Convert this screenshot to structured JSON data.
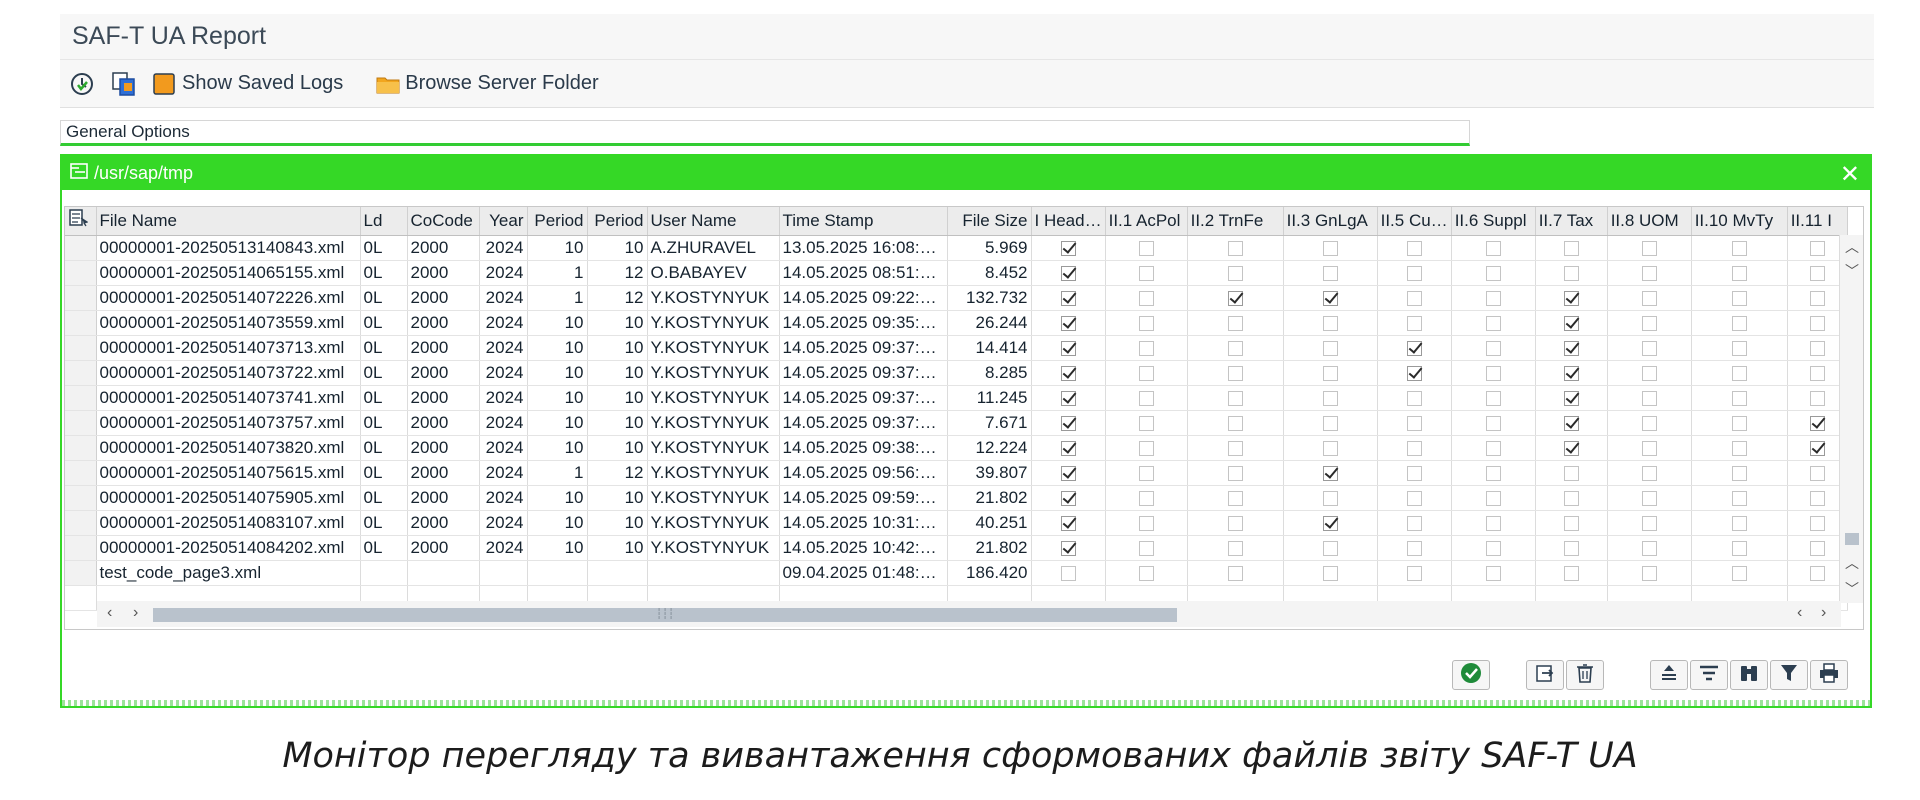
{
  "window": {
    "title": "SAF-T UA Report"
  },
  "toolbar": {
    "show_logs_label": "Show Saved Logs",
    "browse_folder_label": "Browse Server Folder"
  },
  "general_options": {
    "label": "General Options"
  },
  "dialog": {
    "path": "/usr/sap/tmp",
    "close_label": "✕"
  },
  "grid": {
    "columns": [
      "File Name",
      "Ld",
      "CoCode",
      "Year",
      "Period",
      "Period",
      "User Name",
      "Time Stamp",
      "File Size",
      "I Head…",
      "II.1 AcPol",
      "II.2 TrnFe",
      "II.3 GnLgA",
      "II.5 Cu…",
      "II.6 Suppl",
      "II.7 Tax",
      "II.8 UOM",
      "II.10 MvTy",
      "II.11 I"
    ],
    "rows": [
      {
        "file": "00000001-20250513140843.xml",
        "ld": "0L",
        "cocode": "2000",
        "year": "2024",
        "p1": "10",
        "p2": "10",
        "user": "A.ZHURAVEL",
        "ts": "13.05.2025 16:08:…",
        "size": "5.969",
        "flags": [
          1,
          0,
          0,
          0,
          0,
          0,
          0,
          0,
          0,
          0
        ]
      },
      {
        "file": "00000001-20250514065155.xml",
        "ld": "0L",
        "cocode": "2000",
        "year": "2024",
        "p1": "1",
        "p2": "12",
        "user": "O.BABAYEV",
        "ts": "14.05.2025 08:51:…",
        "size": "8.452",
        "flags": [
          1,
          0,
          0,
          0,
          0,
          0,
          0,
          0,
          0,
          0
        ]
      },
      {
        "file": "00000001-20250514072226.xml",
        "ld": "0L",
        "cocode": "2000",
        "year": "2024",
        "p1": "1",
        "p2": "12",
        "user": "Y.KOSTYNYUK",
        "ts": "14.05.2025 09:22:…",
        "size": "132.732",
        "flags": [
          1,
          0,
          1,
          1,
          0,
          0,
          1,
          0,
          0,
          0
        ]
      },
      {
        "file": "00000001-20250514073559.xml",
        "ld": "0L",
        "cocode": "2000",
        "year": "2024",
        "p1": "10",
        "p2": "10",
        "user": "Y.KOSTYNYUK",
        "ts": "14.05.2025 09:35:…",
        "size": "26.244",
        "flags": [
          1,
          0,
          0,
          0,
          0,
          0,
          1,
          0,
          0,
          0
        ]
      },
      {
        "file": "00000001-20250514073713.xml",
        "ld": "0L",
        "cocode": "2000",
        "year": "2024",
        "p1": "10",
        "p2": "10",
        "user": "Y.KOSTYNYUK",
        "ts": "14.05.2025 09:37:…",
        "size": "14.414",
        "flags": [
          1,
          0,
          0,
          0,
          1,
          0,
          1,
          0,
          0,
          0
        ]
      },
      {
        "file": "00000001-20250514073722.xml",
        "ld": "0L",
        "cocode": "2000",
        "year": "2024",
        "p1": "10",
        "p2": "10",
        "user": "Y.KOSTYNYUK",
        "ts": "14.05.2025 09:37:…",
        "size": "8.285",
        "flags": [
          1,
          0,
          0,
          0,
          1,
          0,
          1,
          0,
          0,
          0
        ]
      },
      {
        "file": "00000001-20250514073741.xml",
        "ld": "0L",
        "cocode": "2000",
        "year": "2024",
        "p1": "10",
        "p2": "10",
        "user": "Y.KOSTYNYUK",
        "ts": "14.05.2025 09:37:…",
        "size": "11.245",
        "flags": [
          1,
          0,
          0,
          0,
          0,
          0,
          1,
          0,
          0,
          0
        ]
      },
      {
        "file": "00000001-20250514073757.xml",
        "ld": "0L",
        "cocode": "2000",
        "year": "2024",
        "p1": "10",
        "p2": "10",
        "user": "Y.KOSTYNYUK",
        "ts": "14.05.2025 09:37:…",
        "size": "7.671",
        "flags": [
          1,
          0,
          0,
          0,
          0,
          0,
          1,
          0,
          0,
          1
        ]
      },
      {
        "file": "00000001-20250514073820.xml",
        "ld": "0L",
        "cocode": "2000",
        "year": "2024",
        "p1": "10",
        "p2": "10",
        "user": "Y.KOSTYNYUK",
        "ts": "14.05.2025 09:38:…",
        "size": "12.224",
        "flags": [
          1,
          0,
          0,
          0,
          0,
          0,
          1,
          0,
          0,
          1
        ]
      },
      {
        "file": "00000001-20250514075615.xml",
        "ld": "0L",
        "cocode": "2000",
        "year": "2024",
        "p1": "1",
        "p2": "12",
        "user": "Y.KOSTYNYUK",
        "ts": "14.05.2025 09:56:…",
        "size": "39.807",
        "flags": [
          1,
          0,
          0,
          1,
          0,
          0,
          0,
          0,
          0,
          0
        ]
      },
      {
        "file": "00000001-20250514075905.xml",
        "ld": "0L",
        "cocode": "2000",
        "year": "2024",
        "p1": "10",
        "p2": "10",
        "user": "Y.KOSTYNYUK",
        "ts": "14.05.2025 09:59:…",
        "size": "21.802",
        "flags": [
          1,
          0,
          0,
          0,
          0,
          0,
          0,
          0,
          0,
          0
        ]
      },
      {
        "file": "00000001-20250514083107.xml",
        "ld": "0L",
        "cocode": "2000",
        "year": "2024",
        "p1": "10",
        "p2": "10",
        "user": "Y.KOSTYNYUK",
        "ts": "14.05.2025 10:31:…",
        "size": "40.251",
        "flags": [
          1,
          0,
          0,
          1,
          0,
          0,
          0,
          0,
          0,
          0
        ]
      },
      {
        "file": "00000001-20250514084202.xml",
        "ld": "0L",
        "cocode": "2000",
        "year": "2024",
        "p1": "10",
        "p2": "10",
        "user": "Y.KOSTYNYUK",
        "ts": "14.05.2025 10:42:…",
        "size": "21.802",
        "flags": [
          1,
          0,
          0,
          0,
          0,
          0,
          0,
          0,
          0,
          0
        ]
      },
      {
        "file": "test_code_page3.xml",
        "ld": "",
        "cocode": "",
        "year": "",
        "p1": "",
        "p2": "",
        "user": "",
        "ts": "09.04.2025 01:48:…",
        "size": "186.420",
        "flags": [
          0,
          0,
          0,
          0,
          0,
          0,
          0,
          0,
          0,
          0
        ]
      }
    ]
  },
  "caption": "Монітор перегляду та вивантаження сформованих файлів звіту SAF-T UA",
  "colors": {
    "accent": "#35d826",
    "header_bg": "#ececec"
  },
  "icons": [
    "refresh-clock-icon",
    "copy-icon",
    "log-book-icon",
    "folder-icon",
    "layout-icon",
    "checkmark-icon",
    "export-icon",
    "delete-icon",
    "sort-ascending-icon",
    "filter-lines-icon",
    "binoculars-icon",
    "filter-funnel-icon",
    "print-icon"
  ]
}
